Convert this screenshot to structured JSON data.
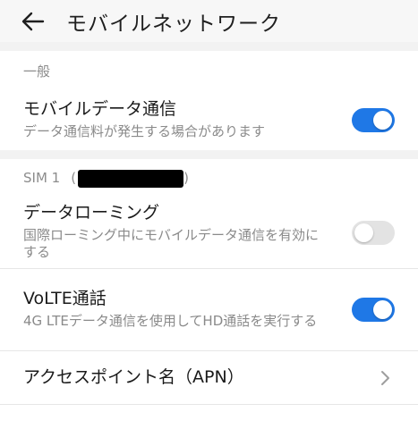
{
  "header": {
    "title": "モバイルネットワーク"
  },
  "general": {
    "label": "一般",
    "mobile_data": {
      "title": "モバイルデータ通信",
      "subtitle": "データ通信料が発生する場合があります",
      "on": true
    }
  },
  "sim": {
    "label": "SIM 1",
    "open_paren": "(",
    "close_paren": ")",
    "roaming": {
      "title": "データローミング",
      "subtitle": "国際ローミング中にモバイルデータ通信を有効にする",
      "on": false
    },
    "volte": {
      "title": "VoLTE通話",
      "subtitle": "4G LTEデータ通信を使用してHD通話を実行する",
      "on": true
    },
    "apn": {
      "title": "アクセスポイント名（APN）"
    }
  },
  "colors": {
    "accent": "#1f78e6",
    "toggle_off": "#e3e3e3"
  }
}
